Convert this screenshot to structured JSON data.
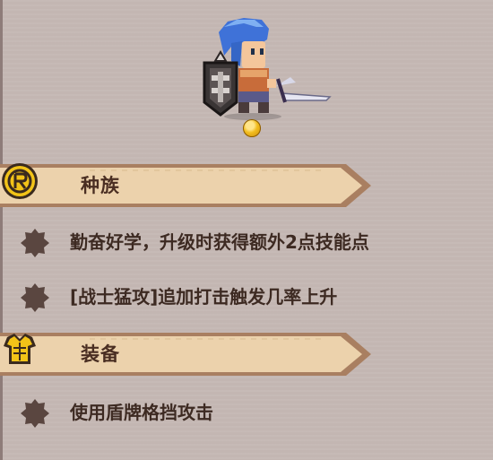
{
  "race_section": {
    "title": "种族",
    "icon": "race-coin-icon",
    "traits": [
      "勤奋好学，升级时获得额外2点技能点",
      "[战士猛攻]追加打击触发几率上升"
    ]
  },
  "equipment_section": {
    "title": "装备",
    "icon": "armor-icon",
    "traits": [
      "使用盾牌格挡攻击"
    ]
  },
  "colors": {
    "banner_fill": "#ecd2ac",
    "banner_border": "#a97f61",
    "gold": "#f2bd1f",
    "bullet": "#5a4640"
  }
}
